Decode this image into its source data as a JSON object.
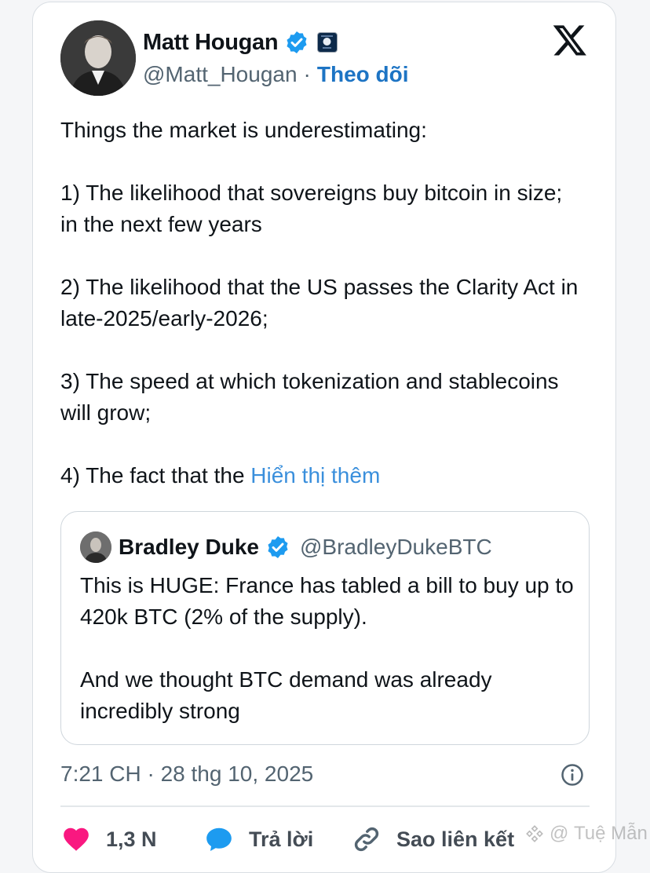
{
  "author": {
    "display_name": "Matt Hougan",
    "handle": "@Matt_Hougan",
    "separator": "·",
    "follow_label": "Theo dõi"
  },
  "post": {
    "paragraphs": [
      "Things the market is underestimating:",
      "1) The likelihood that sovereigns buy bitcoin in size; in the next few years",
      "2) The likelihood that the US passes the Clarity Act in late-2025/early-2026;",
      "3) The speed at which tokenization and stablecoins will grow;"
    ],
    "last_line_prefix": "4) The fact that the ",
    "show_more_label": "Hiển thị thêm"
  },
  "quoted_post": {
    "display_name": "Bradley Duke",
    "handle": "@BradleyDukeBTC",
    "paragraphs": [
      "This is HUGE: France has tabled a bill to buy up to 420k BTC (2% of the supply).",
      "And we thought BTC demand was already incredibly strong"
    ]
  },
  "timestamp": "7:21 CH · 28 thg 10, 2025",
  "actions": {
    "likes": "1,3 N",
    "reply_label": "Trả lời",
    "copy_link_label": "Sao liên kết"
  },
  "watermark": "Tuệ Mẫn",
  "colors": {
    "accent": "#1d9bf0",
    "follow": "#1d74c4",
    "show_more": "#3a8fdc",
    "like": "#f91880",
    "secondary_text": "#536471"
  }
}
